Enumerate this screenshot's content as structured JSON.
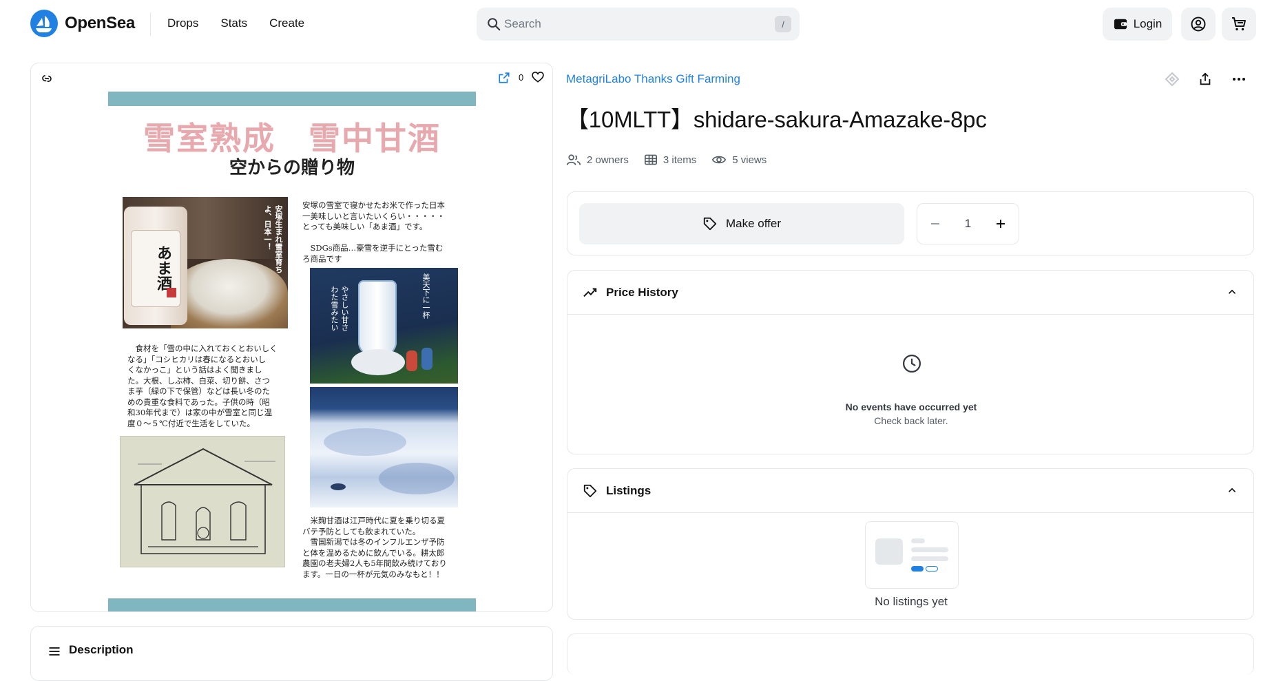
{
  "header": {
    "brand": "OpenSea",
    "nav": [
      "Drops",
      "Stats",
      "Create"
    ],
    "search_placeholder": "Search",
    "search_shortcut": "/",
    "login_label": "Login",
    "icons": [
      "search-icon",
      "wallet-icon",
      "profile-icon",
      "cart-icon"
    ]
  },
  "media": {
    "favorites_count": "0",
    "artwork": {
      "title": "雪室熟成　雪中甘酒",
      "subtitle": "空からの贈り物",
      "text_right_top": "安塚の雪室で寝かせたお米で作った日本\n一美味しいと言いたいくらい・・・・・\nとっても美味しい「あま酒」です。\n\n　SDGs商品…豪雪を逆手にとった雪む\nろ商品です",
      "text_left_mid": "　食材を「雪の中に入れておくとおいしく\nなる」「コシヒカリは春になるとおいし\nくなかっこ」という話はよく聞きまし\nた。大根、しぶ柿、白菜、切り餅、さつ\nま芋（緑の下で保管）などは長い冬のた\nめの貴重な食料であった。子供の時（昭\n和30年代まで）は家の中が雪室と同じ温\n度０～５℃付近で生活をしていた。",
      "text_right_bottom": "　米麹甘酒は江戸時代に夏を乗り切る夏\nバテ予防としても飲まれていた。\n　雪国新潟では冬のインフルエンザ予防\nと体を温めるために飲んでいる。耕太郎\n農園の老夫婦2人も5年間飲み続けており\nます。一日の一杯が元気のみなもと！！",
      "pkg_label": "あま酒",
      "pkg_side": "安塚生まれ雪室育ち\nよ、日本一！",
      "glass_caption1": "美天下に一杯",
      "glass_caption2": "やさしい甘さ\nわた雪みたい"
    }
  },
  "description": {
    "title": "Description"
  },
  "item": {
    "collection": "MetagriLabo Thanks Gift Farming",
    "title": "【10MLTT】shidare-sakura-Amazake-8pc",
    "owners": "2 owners",
    "items": "3 items",
    "views": "5 views"
  },
  "offer": {
    "label": "Make offer",
    "quantity": "1"
  },
  "price_history": {
    "title": "Price History",
    "empty_title": "No events have occurred yet",
    "empty_sub": "Check back later."
  },
  "listings": {
    "title": "Listings",
    "empty": "No listings yet"
  },
  "colors": {
    "accent": "#2081e2",
    "band": "#7fb6bf",
    "title_pink": "#e7a9ad"
  }
}
